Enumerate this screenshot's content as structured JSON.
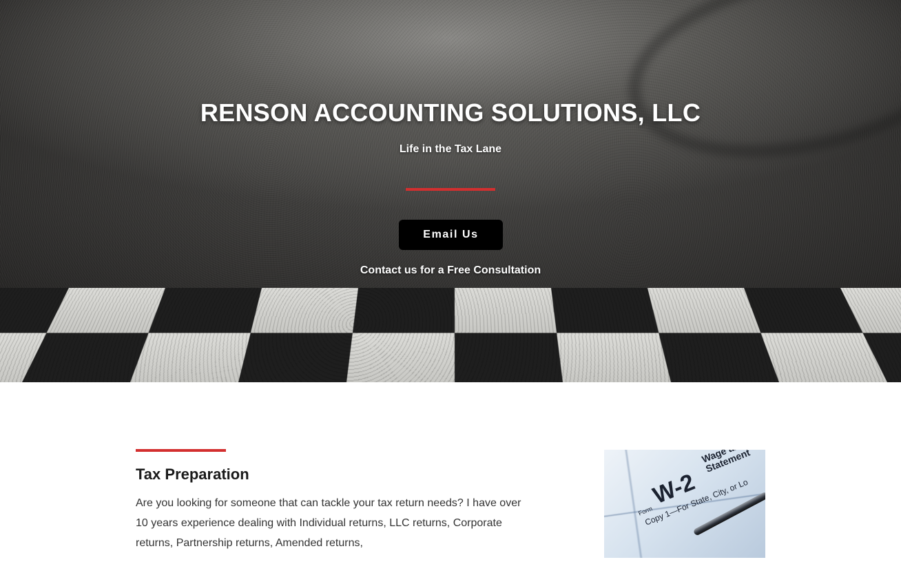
{
  "hero": {
    "title": "RENSON ACCOUNTING SOLUTIONS, LLC",
    "subtitle": "Life in the Tax Lane",
    "button_label": "Email Us",
    "contact_text": "Contact us for a Free Consultation"
  },
  "service": {
    "title": "Tax Preparation",
    "body": "Are you looking for someone that can tackle your tax return needs? I have over 10 years experience dealing with Individual returns, LLC returns, Corporate returns, Partnership returns, Amended returns,"
  },
  "w2_image": {
    "form_label": "Form",
    "form_number": "W-2",
    "heading_line1": "Wage and",
    "heading_line2": "Statement",
    "copy_line": "Copy 1—For State, City, or Lo"
  },
  "colors": {
    "accent": "#d32f2f",
    "button_bg": "#000000",
    "text_dark": "#1a1a1a",
    "body_text": "#333333"
  }
}
